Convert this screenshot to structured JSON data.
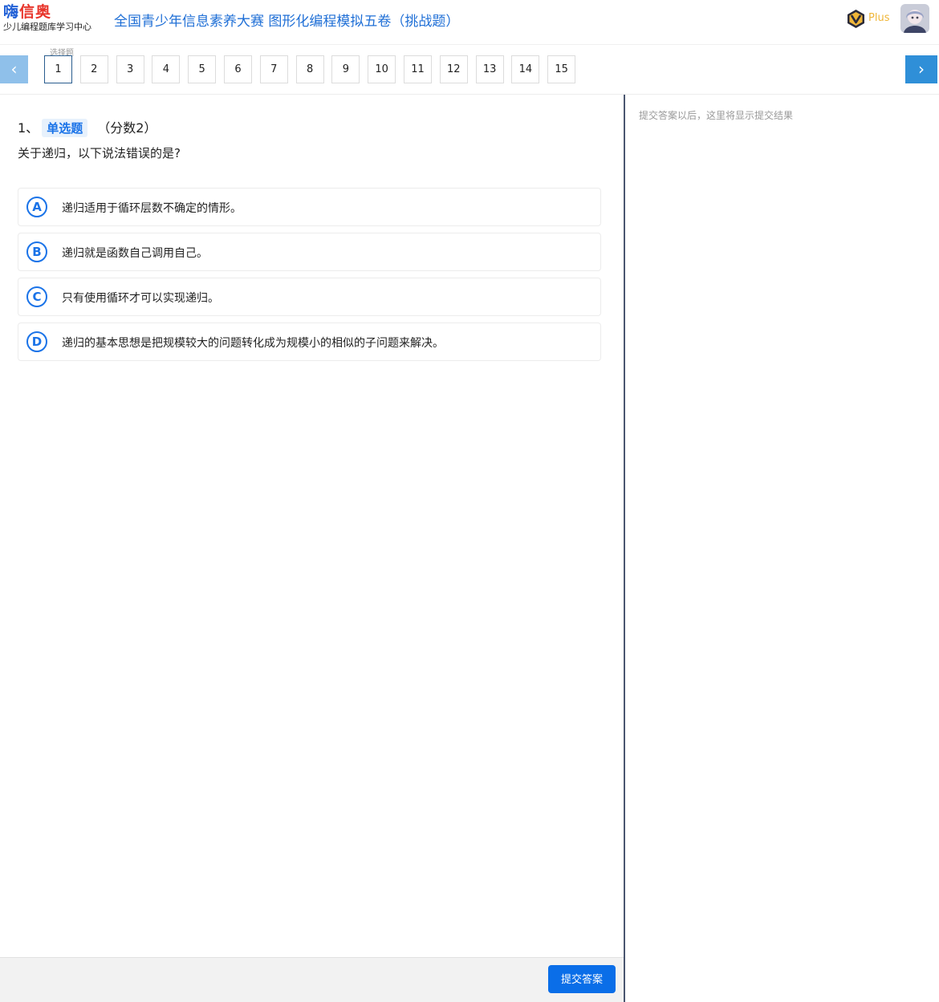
{
  "header": {
    "logo_main_a": "嗨",
    "logo_main_b": "信奥",
    "logo_sub": "少儿编程题库学习中心",
    "exam_title": "全国青少年信息素养大赛 图形化编程模拟五卷（挑战题）",
    "vip_label": "Plus"
  },
  "nav": {
    "prev_icon": "chevron-left-icon",
    "next_icon": "chevron-right-icon",
    "section_label": "选择题",
    "questions": [
      "1",
      "2",
      "3",
      "4",
      "5",
      "6",
      "7",
      "8",
      "9",
      "10",
      "11",
      "12",
      "13",
      "14",
      "15"
    ],
    "active": "1"
  },
  "question": {
    "number": "1、",
    "type": "单选题",
    "score": "（分数2）",
    "stem": "关于递归，以下说法错误的是?",
    "options": [
      {
        "letter": "A",
        "text": "递归适用于循环层数不确定的情形。"
      },
      {
        "letter": "B",
        "text": "递归就是函数自己调用自己。"
      },
      {
        "letter": "C",
        "text": "只有使用循环才可以实现递归。"
      },
      {
        "letter": "D",
        "text": "递归的基本思想是把规模较大的问题转化成为规模小的相似的子问题来解决。"
      }
    ]
  },
  "result": {
    "hint": "提交答案以后，这里将显示提交结果"
  },
  "footer": {
    "submit_label": "提交答案"
  },
  "colors": {
    "accent": "#1a73e8",
    "title": "#1f6fd6",
    "vip": "#f0b638",
    "submit": "#0a6ee8"
  }
}
